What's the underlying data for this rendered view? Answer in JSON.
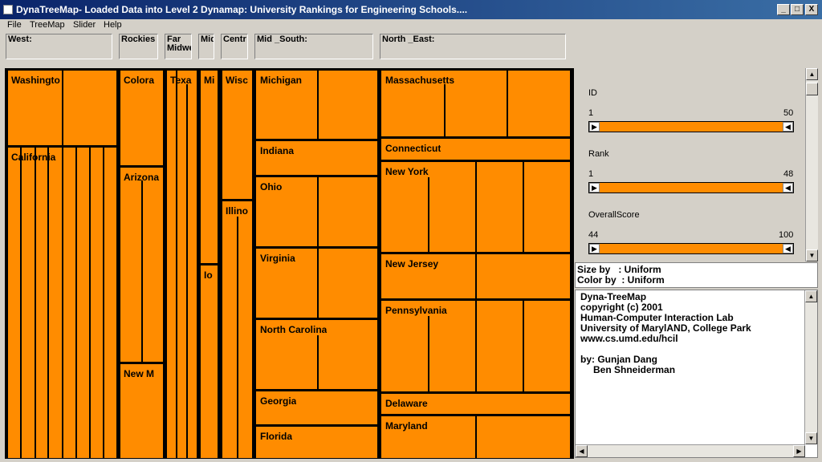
{
  "window": {
    "title": "DynaTreeMap- Loaded Data into Level 2 Dynamap:  University Rankings for Engineering Schools....",
    "minimize": "_",
    "maximize": "□",
    "close": "X"
  },
  "menu": [
    "File",
    "TreeMap",
    "Slider",
    "Help"
  ],
  "regions": [
    "West:",
    "Rockies",
    "Far\nMidwe",
    "Mid",
    "Centr",
    "Mid _South:",
    "North _East:"
  ],
  "states": {
    "washington": "Washingto",
    "california": "California",
    "colorado": "Colora",
    "arizona": "Arizona",
    "new_mexico": "New M",
    "texas": "Texa",
    "mi": "Mi",
    "iowa": "Io",
    "wisconsin": "Wisc",
    "illinois": "Illino",
    "michigan": "Michigan",
    "indiana": "Indiana",
    "ohio": "Ohio",
    "virginia": "Virginia",
    "north_carolina": "North Carolina",
    "georgia": "Georgia",
    "florida": "Florida",
    "massachusetts": "Massachusetts",
    "connecticut": "Connecticut",
    "new_york": "New York",
    "new_jersey": "New Jersey",
    "pennsylvania": "Pennsylvania",
    "delaware": "Delaware",
    "maryland": "Maryland"
  },
  "sliders": [
    {
      "name": "ID",
      "min": "1",
      "max": "50"
    },
    {
      "name": "Rank",
      "min": "1",
      "max": "48"
    },
    {
      "name": "OverallScore",
      "min": "44",
      "max": "100"
    }
  ],
  "info": {
    "size_by": "Size by   : Uniform",
    "color_by": "Color by  : Uniform"
  },
  "about": {
    "line1": "Dyna-TreeMap",
    "line2": "copyright (c) 2001",
    "line3": "Human-Computer Interaction Lab",
    "line4": "University of MarylAND, College Park",
    "line5": "www.cs.umd.edu/hcil",
    "line6": "by:  Gunjan Dang",
    "line7": "Ben Shneiderman"
  },
  "colors": {
    "cell": "#ff8c00",
    "titlebar": "#0a246a"
  }
}
